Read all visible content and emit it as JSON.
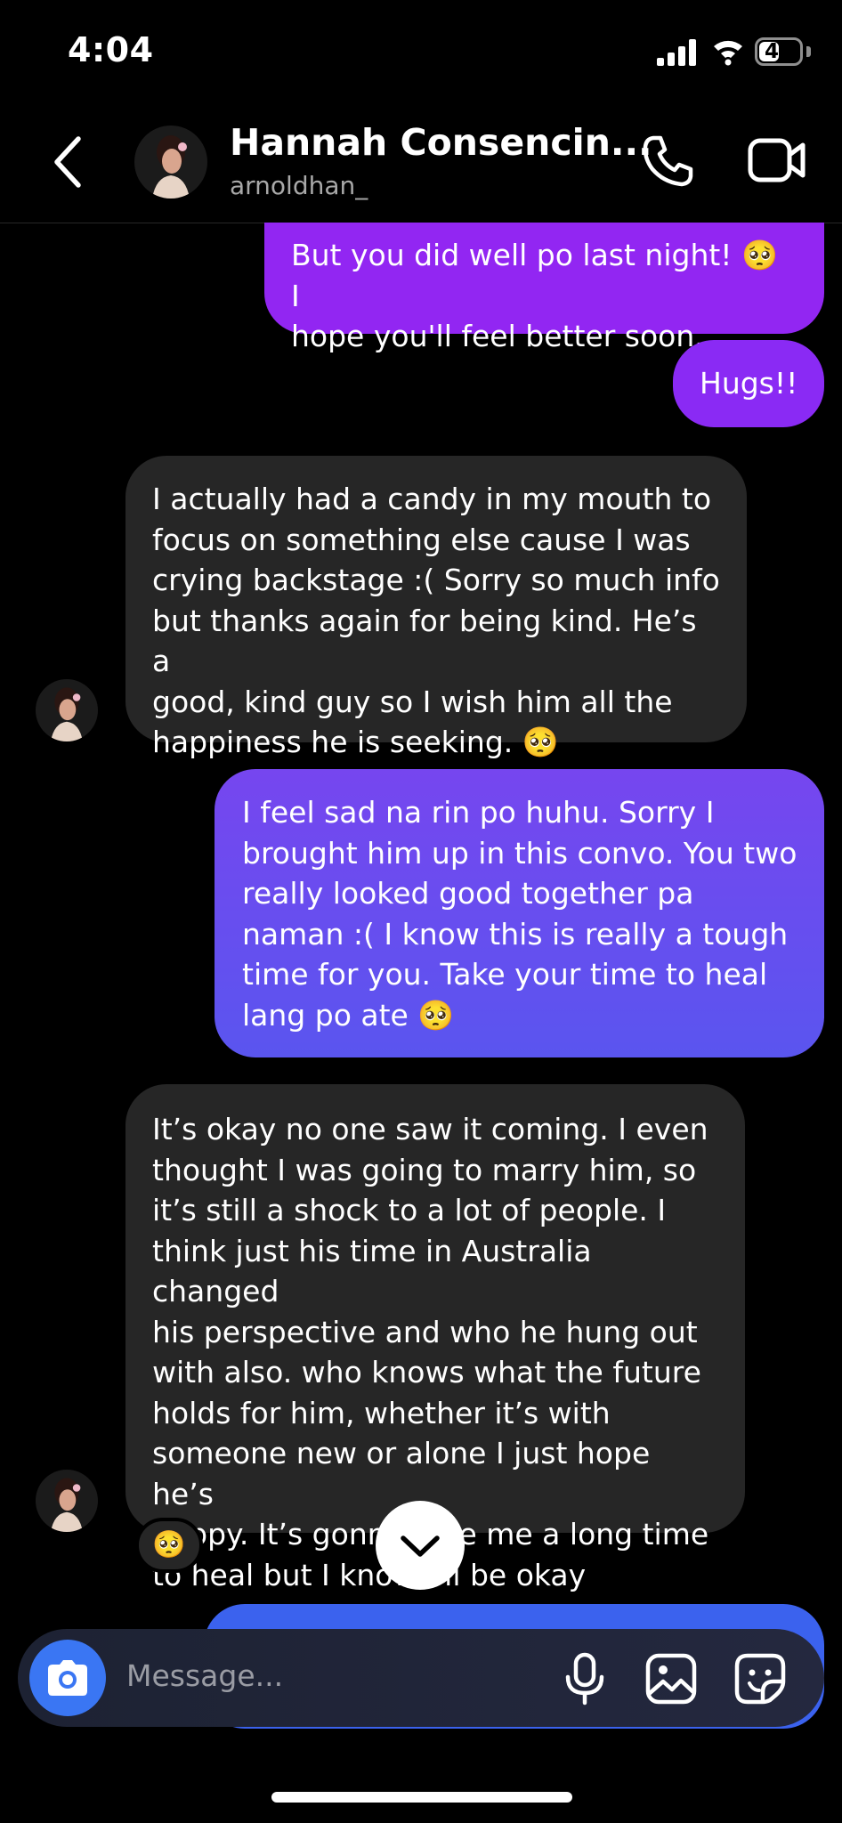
{
  "status_bar": {
    "time": "4:04",
    "battery": "45",
    "signal_icon": "cellular-signal-icon",
    "wifi_icon": "wifi-icon"
  },
  "header": {
    "back_icon": "chevron-left-icon",
    "name": "Hannah Consencin...",
    "username": "arnoldhan_",
    "call_icon": "phone-icon",
    "video_icon": "video-camera-icon"
  },
  "messages": [
    {
      "direction": "sent",
      "lines": [
        "But you did well po last night! 🥺 I",
        "hope you'll feel better soon..."
      ]
    },
    {
      "direction": "sent",
      "lines": [
        "Hugs!!"
      ]
    },
    {
      "direction": "received",
      "lines": [
        "I actually had a candy in my mouth to",
        "focus on something else cause I was",
        "crying backstage :( Sorry so much info",
        "but thanks again for being kind. He’s a",
        "good, kind guy so I wish him all the",
        "happiness he is seeking. 🥺"
      ]
    },
    {
      "direction": "sent",
      "lines": [
        "I feel sad na rin po huhu. Sorry I",
        "brought him up in this convo. You two",
        "really looked good together pa",
        "naman :( I know this is really a tough",
        "time for you. Take your time to heal",
        "lang po ate 🥺"
      ]
    },
    {
      "direction": "received",
      "lines": [
        "It’s okay no one saw it coming. I even",
        "thought I was going to marry him, so",
        "it’s still a shock to a lot of people. I",
        "think just his time in Australia changed",
        "his perspective and who he hung out",
        "with also. who knows what the future",
        "holds for him, whether it’s with",
        "someone new or alone I just hope he’s",
        "happy. It’s gonna take me a long time",
        "to heal but I know I’ll be okay"
      ],
      "reaction": "🥺"
    }
  ],
  "composer": {
    "placeholder": "Message...",
    "camera_icon": "camera-icon",
    "mic_icon": "microphone-icon",
    "gallery_icon": "image-gallery-icon",
    "sticker_icon": "sticker-icon"
  },
  "scroll_down_icon": "chevron-down-icon",
  "colors": {
    "background": "#000000",
    "received_bubble": "#262626",
    "sent_purple": "#9226f2",
    "sent_gradient_top": "#7646ef",
    "sent_gradient_bottom": "#5a55ef",
    "sent_blue": "#3b62ee",
    "camera_button": "#3a76f3"
  }
}
